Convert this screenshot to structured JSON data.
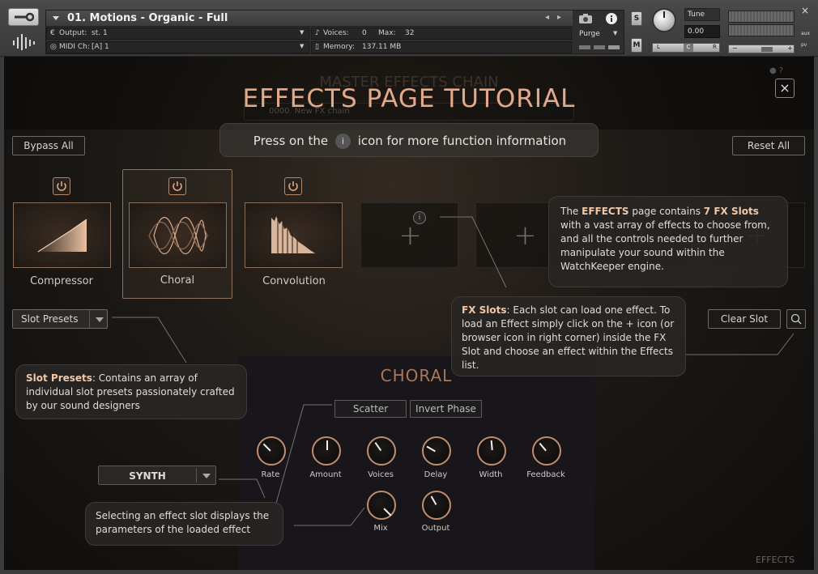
{
  "kontakt": {
    "instrument_title": "01. Motions - Organic - Full",
    "output_label": "Output:",
    "output_value": "st. 1",
    "voices_label": "Voices:",
    "voices_value": "0",
    "max_label": "Max:",
    "max_value": "32",
    "purge_label": "Purge",
    "midi_label": "MIDI Ch:",
    "midi_value": "[A]  1",
    "memory_label": "Memory:",
    "memory_value": "137.11 MB",
    "solo_label": "S",
    "mute_label": "M",
    "tune_label": "Tune",
    "tune_value": "0.00",
    "pan_left": "L",
    "pan_center": "C",
    "pan_right": "R",
    "vol_minus": "−",
    "vol_plus": "+",
    "side_aux": "aux",
    "side_pv": "pv",
    "close_x": "×"
  },
  "plugin": {
    "ghost_title": "MASTER EFFECTS CHAIN",
    "ghost_chain_name": "0000. New FX chain",
    "tutorial_title": "EFFECTS PAGE TUTORIAL",
    "close_label": "×",
    "press_text_before": "Press on the",
    "press_icon": "i",
    "press_text_after": "icon for more function information",
    "bypass_all": "Bypass All",
    "reset_all": "Reset All",
    "slots": [
      {
        "label": "Compressor",
        "icon": "compressor-graph-icon"
      },
      {
        "label": "Choral",
        "icon": "choral-wave-icon"
      },
      {
        "label": "Convolution",
        "icon": "convolution-ir-icon"
      },
      {
        "label": "",
        "icon": "plus-icon"
      },
      {
        "label": "",
        "icon": "plus-icon"
      },
      {
        "label": "",
        "icon": "plus-icon"
      },
      {
        "label": "",
        "icon": "plus-icon"
      }
    ],
    "slot_info_icon": "i",
    "slot_presets_label": "Slot Presets",
    "clear_slot": "Clear Slot",
    "effect_title": "CHORAL",
    "scatter_label": "Scatter",
    "invert_phase_label": "Invert Phase",
    "synth_label": "SYNTH",
    "knobs_row1": [
      {
        "label": "Rate",
        "angle": -45
      },
      {
        "label": "Amount",
        "angle": 0
      },
      {
        "label": "Voices",
        "angle": -35
      },
      {
        "label": "Delay",
        "angle": -60
      },
      {
        "label": "Width",
        "angle": -5
      },
      {
        "label": "Feedback",
        "angle": -40
      }
    ],
    "knobs_row2": [
      {
        "label": "Mix",
        "angle": 135
      },
      {
        "label": "Output",
        "angle": -30
      }
    ],
    "bottom_tabs": [
      "EFFECTS"
    ]
  },
  "tooltips": {
    "effects": {
      "p1": "The ",
      "b1": "EFFECTS",
      "p2": " page contains ",
      "b2": "7 FX Slots",
      "p3": " with a vast array of effects to choose from, and all the controls needed to further manipulate your sound within the WatchKeeper engine."
    },
    "fx_slots": {
      "b1": "FX Slots",
      "p1": ": Each slot can load one effect. To load an Effect simply click on the + icon (or browser icon in right corner) inside the FX Slot and choose an effect within the Effects list."
    },
    "slot_presets": {
      "b1": "Slot Presets",
      "p1": ": Contains an array of individual slot presets passionately crafted by our sound designers"
    },
    "selecting": {
      "p1": "Selecting an effect slot displays the parameters of the loaded effect"
    }
  }
}
